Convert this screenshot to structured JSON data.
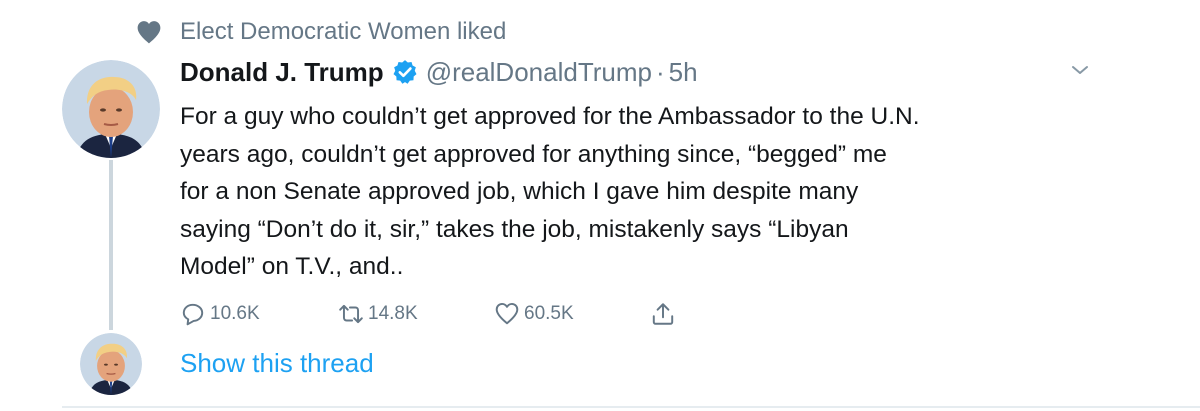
{
  "social_context": {
    "icon": "heart-icon",
    "text": "Elect Democratic Women liked"
  },
  "tweet": {
    "author": {
      "name": "Donald J. Trump",
      "verified": true,
      "handle": "@realDonaldTrump",
      "avatar_icon": "avatar"
    },
    "separator": "·",
    "time": "5h",
    "text": "For a guy who couldn’t get approved for the Ambassador to the U.N.\nyears ago, couldn’t get approved for anything since, “begged” me\nfor a non Senate approved job, which I gave him despite many\nsaying “Don’t do it, sir,” takes the job, mistakenly says “Libyan\nModel” on T.V., and..",
    "actions": {
      "replies": "10.6K",
      "retweets": "14.8K",
      "likes": "60.5K"
    },
    "show_thread_label": "Show this thread"
  },
  "colors": {
    "primary_text": "#14171a",
    "secondary_text": "#657786",
    "accent_blue": "#1da1f2",
    "thread_line": "#ccd6dd",
    "divider": "#e6ecf0"
  }
}
